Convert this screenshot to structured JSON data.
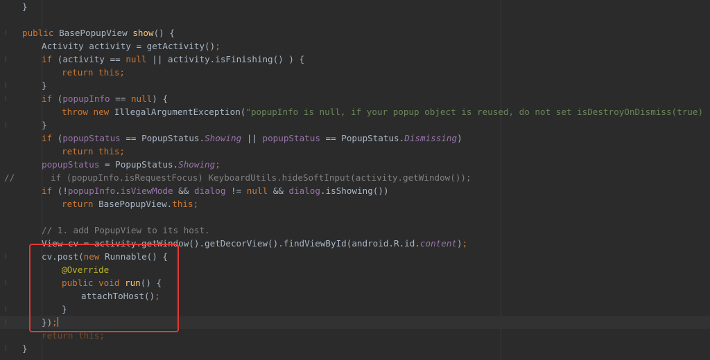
{
  "editor": {
    "gutter_marker": "//",
    "lines": {
      "l0": [
        "}"
      ],
      "l1": [
        "public",
        " BasePopupView ",
        "show",
        "() {"
      ],
      "l2": [
        "Activity activity = getActivity()",
        ";"
      ],
      "l3": [
        "if",
        " (activity == ",
        "null",
        " || activity.isFinishing() ) {"
      ],
      "l4": [
        "return this",
        ";"
      ],
      "l5": [
        "}"
      ],
      "l6": [
        "if",
        " (",
        "popupInfo",
        " == ",
        "null",
        ") {"
      ],
      "l7": [
        "throw new",
        " IllegalArgumentException(",
        "\"popupInfo is null, if your popup object is reused, do not set isDestroyOnDismiss(true) !\"",
        ")",
        ";"
      ],
      "l8": [
        "}"
      ],
      "l9": [
        "if",
        " (",
        "popupStatus",
        " == PopupStatus.",
        "Showing",
        " || ",
        "popupStatus",
        " == PopupStatus.",
        "Dismissing",
        ")"
      ],
      "l10": [
        "return this",
        ";"
      ],
      "l11": [
        "popupStatus",
        " = PopupStatus.",
        "Showing",
        ";"
      ],
      "l12": [
        "if (popupInfo.isRequestFocus) KeyboardUtils.hideSoftInput(activity.getWindow());"
      ],
      "l13": [
        "if",
        " (!",
        "popupInfo",
        ".",
        "isViewMode",
        " && ",
        "dialog",
        " != ",
        "null",
        " && ",
        "dialog",
        ".isShowing())"
      ],
      "l14": [
        "return",
        " BasePopupView.",
        "this",
        ";"
      ],
      "l16": [
        "// 1. add PopupView to its host."
      ],
      "l17": [
        "View cv = activity.getWindow().getDecorView().findViewById(android.R.id.",
        "content",
        ")",
        ";"
      ],
      "l18": [
        "cv.post(",
        "new",
        " Runnable() {"
      ],
      "l19": [
        "@Override"
      ],
      "l20": [
        "public void",
        " ",
        "run",
        "() {"
      ],
      "l21": [
        "attachToHost()",
        ";"
      ],
      "l22": [
        "}"
      ],
      "l23": [
        "})",
        ";"
      ],
      "l24": [
        "return this",
        ";"
      ],
      "l25": [
        "}"
      ]
    }
  },
  "colors": {
    "background": "#2b2b2b",
    "keyword": "#cc7832",
    "method_decl": "#ffc66d",
    "string": "#6a8759",
    "field": "#9876aa",
    "comment": "#808080",
    "annotation": "#bbb529",
    "highlight_box": "#e53935"
  }
}
